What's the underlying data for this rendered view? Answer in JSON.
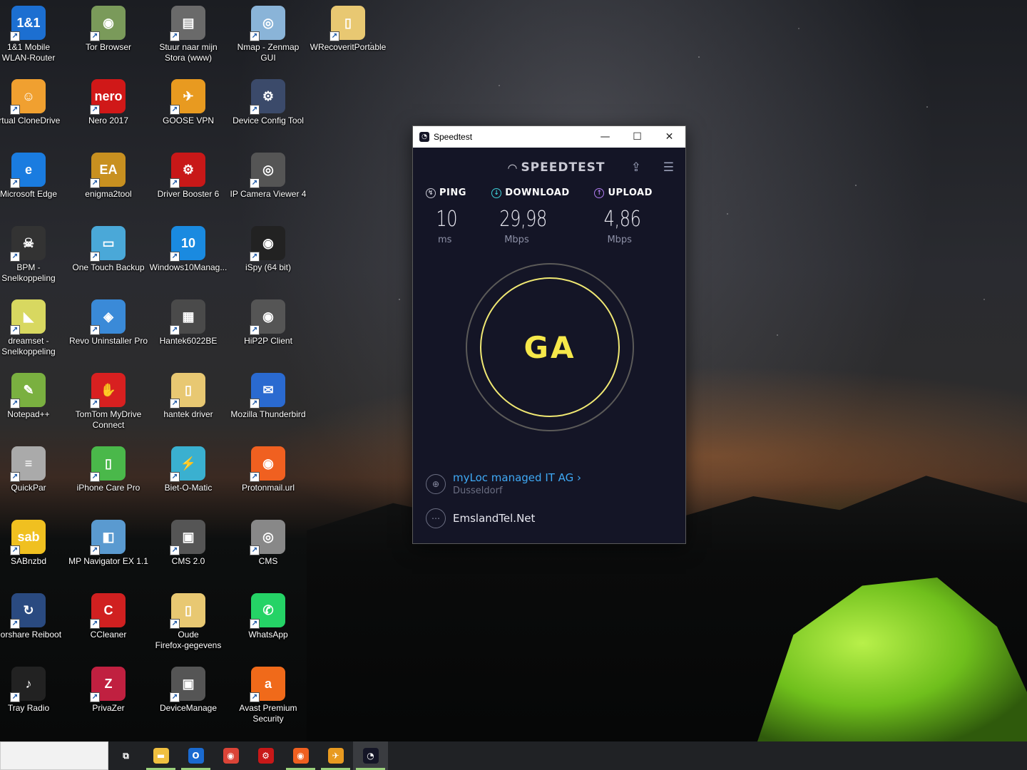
{
  "desktop": {
    "icons": [
      {
        "label": "1&1 Mobile\nWLAN-Router",
        "icon": "1and1-router-icon",
        "glyph": "1&1",
        "color": "#1c6fd1"
      },
      {
        "label": "Tor Browser",
        "icon": "tor-browser-icon",
        "glyph": "◉",
        "color": "#7a9a5a"
      },
      {
        "label": "Stuur naar mijn\nStora (www)",
        "icon": "stora-folder-icon",
        "glyph": "▤",
        "color": "#6a6a6a"
      },
      {
        "label": "Nmap - Zenmap\nGUI",
        "icon": "nmap-eye-icon",
        "glyph": "◎",
        "color": "#8ab4d8"
      },
      {
        "label": "WRecoveritPortable",
        "icon": "folder-icon",
        "glyph": "▯",
        "color": "#e8c872"
      },
      {
        "label": "irtual CloneDrive",
        "icon": "clonedrive-sheep-icon",
        "glyph": "☺",
        "color": "#f0a030"
      },
      {
        "label": "Nero 2017",
        "icon": "nero-icon",
        "glyph": "nero",
        "color": "#d01818"
      },
      {
        "label": "GOOSE VPN",
        "icon": "goose-vpn-icon",
        "glyph": "✈",
        "color": "#e89a20"
      },
      {
        "label": "Device Config Tool",
        "icon": "device-config-icon",
        "glyph": "⚙",
        "color": "#3b4a6a"
      },
      {
        "label": "Microsoft Edge",
        "icon": "edge-icon",
        "glyph": "e",
        "color": "#1a7ce0"
      },
      {
        "label": "enigma2tool",
        "icon": "enigma2tool-icon",
        "glyph": "EA",
        "color": "#c89020"
      },
      {
        "label": "Driver Booster 6",
        "icon": "driver-booster-icon",
        "glyph": "⚙",
        "color": "#c81818"
      },
      {
        "label": "IP Camera Viewer 4",
        "icon": "ip-camera-icon",
        "glyph": "◎",
        "color": "#555"
      },
      {
        "label": "BPM -\nSnelkoppeling",
        "icon": "bpm-icon",
        "glyph": "☠",
        "color": "#333"
      },
      {
        "label": "One Touch Backup",
        "icon": "backup-drive-icon",
        "glyph": "▭",
        "color": "#4aa8d8"
      },
      {
        "label": "Windows10Manag...",
        "icon": "windows10-manager-icon",
        "glyph": "10",
        "color": "#1a8ae0"
      },
      {
        "label": "iSpy (64 bit)",
        "icon": "ispy-eye-icon",
        "glyph": "◉",
        "color": "#222"
      },
      {
        "label": "dreamset -\nSnelkoppeling",
        "icon": "satellite-dish-icon",
        "glyph": "◣",
        "color": "#d8d860"
      },
      {
        "label": "Revo Uninstaller Pro",
        "icon": "revo-uninstaller-icon",
        "glyph": "◈",
        "color": "#3a8ad8"
      },
      {
        "label": "Hantek6022BE",
        "icon": "oscilloscope-icon",
        "glyph": "▦",
        "color": "#4a4a4a"
      },
      {
        "label": "HiP2P Client",
        "icon": "camera-lens-icon",
        "glyph": "◉",
        "color": "#555"
      },
      {
        "label": "Notepad++",
        "icon": "notepadpp-icon",
        "glyph": "✎",
        "color": "#7ab040"
      },
      {
        "label": "TomTom MyDrive\nConnect",
        "icon": "tomtom-icon",
        "glyph": "✋",
        "color": "#d82020"
      },
      {
        "label": "hantek driver",
        "icon": "folder-icon",
        "glyph": "▯",
        "color": "#e8c872"
      },
      {
        "label": "Mozilla Thunderbird",
        "icon": "thunderbird-icon",
        "glyph": "✉",
        "color": "#2a6ad0"
      },
      {
        "label": "QuickPar",
        "icon": "quickpar-icon",
        "glyph": "≡",
        "color": "#aaa"
      },
      {
        "label": "iPhone Care Pro",
        "icon": "iphone-care-icon",
        "glyph": "▯",
        "color": "#4ab84a"
      },
      {
        "label": "Biet-O-Matic",
        "icon": "biet-o-matic-icon",
        "glyph": "⚡",
        "color": "#3ab0d0"
      },
      {
        "label": "Protonmail.url",
        "icon": "firefox-icon",
        "glyph": "◉",
        "color": "#f06020"
      },
      {
        "label": "SABnzbd",
        "icon": "sabnzbd-icon",
        "glyph": "sab",
        "color": "#f0c020"
      },
      {
        "label": "MP Navigator EX 1.1",
        "icon": "mp-navigator-icon",
        "glyph": "◧",
        "color": "#5a9ad0"
      },
      {
        "label": "CMS 2.0",
        "icon": "cms-camera-icon",
        "glyph": "▣",
        "color": "#555"
      },
      {
        "label": "CMS",
        "icon": "cms-icon",
        "glyph": "◎",
        "color": "#888"
      },
      {
        "label": "norshare Reiboot",
        "icon": "reiboot-icon",
        "glyph": "↻",
        "color": "#2a4a80"
      },
      {
        "label": "CCleaner",
        "icon": "ccleaner-icon",
        "glyph": "C",
        "color": "#d02020"
      },
      {
        "label": "Oude\nFirefox-gegevens",
        "icon": "folder-icon",
        "glyph": "▯",
        "color": "#e8c872"
      },
      {
        "label": "WhatsApp",
        "icon": "whatsapp-icon",
        "glyph": "✆",
        "color": "#25d366"
      },
      {
        "label": "Tray Radio",
        "icon": "tray-radio-icon",
        "glyph": "♪",
        "color": "#222"
      },
      {
        "label": "PrivaZer",
        "icon": "privazer-icon",
        "glyph": "Z",
        "color": "#c02040"
      },
      {
        "label": "DeviceManage",
        "icon": "device-manage-icon",
        "glyph": "▣",
        "color": "#555"
      },
      {
        "label": "Avast Premium\nSecurity",
        "icon": "avast-icon",
        "glyph": "a",
        "color": "#f06a1a"
      }
    ]
  },
  "window": {
    "title": "Speedtest",
    "minimize": "—",
    "maximize": "☐",
    "close": "✕"
  },
  "speedtest": {
    "brand": "SPEEDTEST",
    "ping": {
      "label": "PING",
      "value": "10",
      "unit": "ms"
    },
    "download": {
      "label": "DOWNLOAD",
      "value": "29,98",
      "unit": "Mbps"
    },
    "upload": {
      "label": "UPLOAD",
      "value": "4,86",
      "unit": "Mbps"
    },
    "go_button": "GA",
    "server": {
      "name": "myLoc managed IT AG ›",
      "location": "Dusseldorf"
    },
    "isp": {
      "name": "EmslandTel.Net"
    },
    "colors": {
      "accent_go": "#f6e84a",
      "download": "#3fd0d8",
      "upload": "#b07cf0",
      "link": "#3fa9f5"
    }
  },
  "taskbar": {
    "items": [
      {
        "name": "task-view-icon",
        "glyph": "⧉",
        "color": "#202225",
        "running": false
      },
      {
        "name": "file-explorer-icon",
        "glyph": "▬",
        "color": "#f0c040",
        "running": true
      },
      {
        "name": "outlook-icon",
        "glyph": "O",
        "color": "#1a6ad0",
        "running": true
      },
      {
        "name": "chrome-icon",
        "glyph": "◉",
        "color": "#db4437",
        "running": false
      },
      {
        "name": "driver-booster-icon",
        "glyph": "⚙",
        "color": "#c81818",
        "running": false
      },
      {
        "name": "firefox-icon",
        "glyph": "◉",
        "color": "#f06020",
        "running": true
      },
      {
        "name": "goose-vpn-icon",
        "glyph": "✈",
        "color": "#e89a20",
        "running": true
      },
      {
        "name": "speedtest-icon",
        "glyph": "◔",
        "color": "#141526",
        "running": true,
        "active": true
      }
    ]
  }
}
